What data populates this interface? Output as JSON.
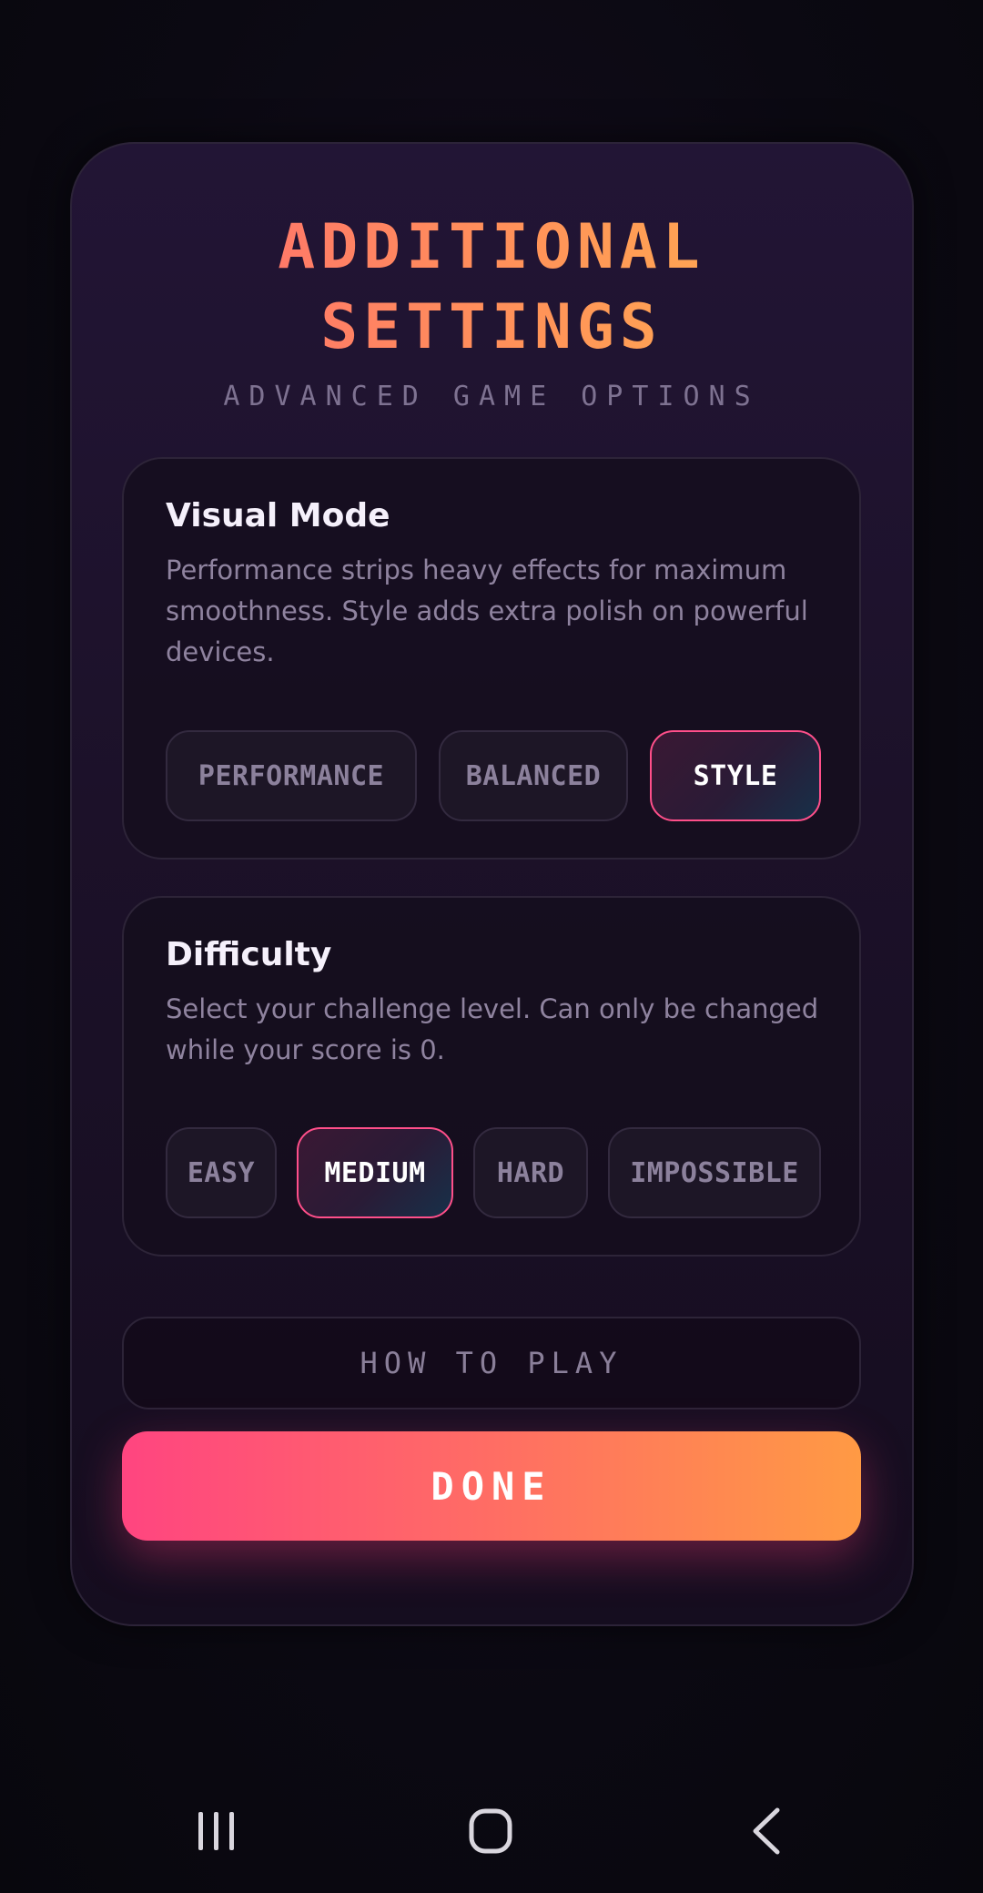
{
  "header": {
    "title_line1": "ADDITIONAL",
    "title_line2": "SETTINGS",
    "subtitle": "ADVANCED GAME OPTIONS"
  },
  "visual_mode": {
    "title": "Visual Mode",
    "description": "Performance strips heavy effects for maximum smoothness. Style adds extra polish on powerful devices.",
    "options": [
      "PERFORMANCE",
      "BALANCED",
      "STYLE"
    ],
    "selected": "STYLE"
  },
  "difficulty": {
    "title": "Difficulty",
    "description": "Select your challenge level. Can only be changed while your score is 0.",
    "options": [
      "EASY",
      "MEDIUM",
      "HARD",
      "IMPOSSIBLE"
    ],
    "selected": "MEDIUM"
  },
  "actions": {
    "how_to_play": "HOW TO PLAY",
    "done": "DONE"
  },
  "navbar": {
    "icons": [
      "recent-apps-icon",
      "home-icon",
      "back-icon"
    ]
  },
  "colors": {
    "accent_pink": "#ff4f8a",
    "accent_orange": "#ff9a44",
    "title_gradient_start": "#ff5f7a",
    "title_gradient_end": "#ffc04a"
  }
}
